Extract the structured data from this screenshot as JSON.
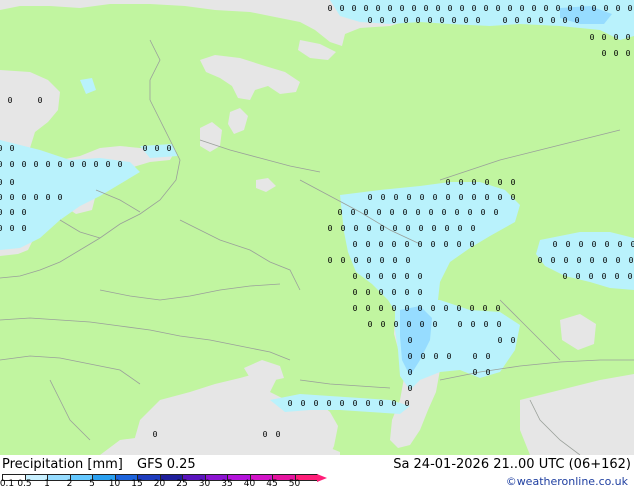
{
  "header": {
    "title": "Precipitation [mm]",
    "model": "GFS 0.25",
    "datetime": "Sa 24-01-2026 21..00 UTC (06+162)",
    "credit": "©weatheronline.co.uk"
  },
  "legend": {
    "values": [
      "0.1",
      "0.5",
      "1",
      "2",
      "5",
      "10",
      "15",
      "20",
      "25",
      "30",
      "35",
      "40",
      "45",
      "50"
    ],
    "colors": [
      "#ffffff",
      "#c8f0ff",
      "#96dcff",
      "#64c8ff",
      "#2aa0f0",
      "#1e64dc",
      "#1e3cbe",
      "#1e1e9b",
      "#5a14be",
      "#8c14d2",
      "#b414dc",
      "#d214c8",
      "#e614a0",
      "#ff1e78"
    ]
  },
  "colors": {
    "land": "#c1f5a0",
    "sea": "#e6e6e6",
    "precip_light": "#b9f2fc",
    "precip_medium": "#96dcff",
    "border": "#9aa09a"
  },
  "map": {
    "region": "Eastern Europe / Western Russia",
    "precip_markers": "0"
  }
}
